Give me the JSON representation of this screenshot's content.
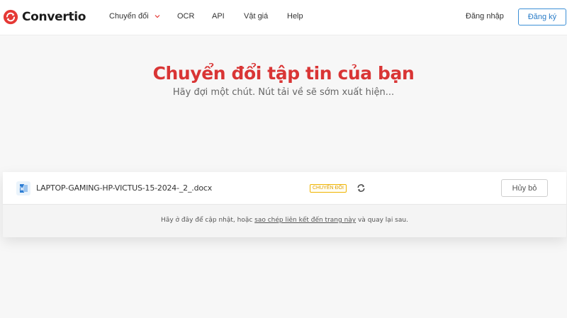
{
  "brand": {
    "name": "Convertio",
    "color": "#e53935"
  },
  "nav": {
    "items": [
      {
        "label": "Chuyển đổi",
        "has_dropdown": true
      },
      {
        "label": "OCR"
      },
      {
        "label": "API"
      },
      {
        "label": "Vật giá"
      },
      {
        "label": "Help"
      }
    ],
    "login_label": "Đăng nhập",
    "signup_label": "Đăng ký"
  },
  "hero": {
    "title": "Chuyển đổi tập tin của bạn",
    "subtitle": "Hãy đợi một chút. Nút tải về sẽ sớm xuất hiện..."
  },
  "file": {
    "icon": "word-doc-icon",
    "name": "LAPTOP-GAMING-HP-VICTUS-15-2024-_2_.docx",
    "status": "CHUYỂN ĐỔI",
    "status_color": "#f0b400",
    "cancel_label": "Hủy bỏ"
  },
  "info": {
    "prefix": "Hãy ở đây để cập nhật, hoặc ",
    "link": "sao chép liên kết đến trang này",
    "suffix": " và quay lại sau."
  },
  "colors": {
    "accent": "#2a7cc7",
    "title": "#d93535"
  }
}
